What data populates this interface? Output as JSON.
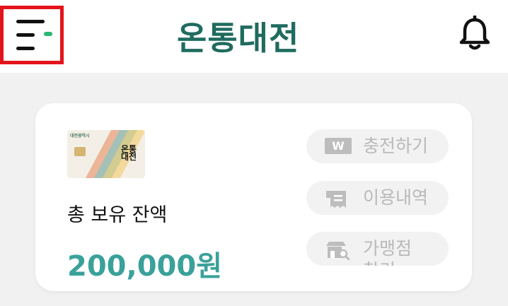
{
  "header": {
    "logo_text": "온통대전",
    "brand_color": "#1f6b5f",
    "menu_icon": "menu-icon",
    "bell_icon": "bell-icon"
  },
  "card": {
    "card_image": {
      "issuer": "대전광역시",
      "brand": "온통대전"
    },
    "balance_label": "총 보유 잔액",
    "balance_amount": "200,000원",
    "accent_color": "#3aa19a",
    "actions": [
      {
        "label": "충전하기",
        "icon": "won-icon",
        "badge": "W"
      },
      {
        "label": "이용내역",
        "icon": "receipt-icon"
      },
      {
        "label": "가맹점 찾기",
        "icon": "store-search-icon"
      }
    ]
  }
}
